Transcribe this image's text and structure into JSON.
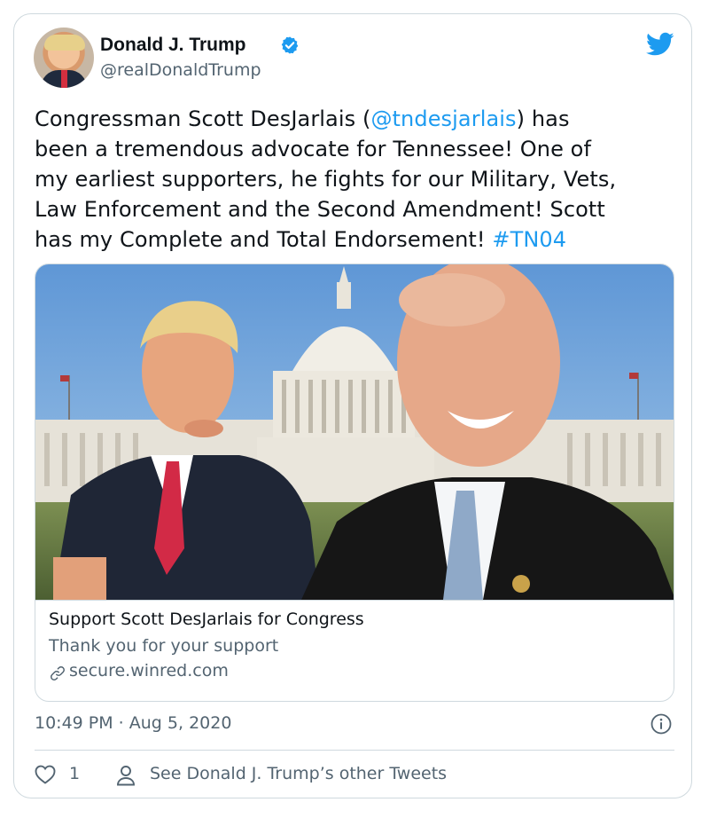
{
  "tweet": {
    "author_name": "Donald J. Trump",
    "author_handle": "@realDonaldTrump",
    "text_lines": [
      {
        "before": "Congressman Scott DesJarlais (",
        "link": "@tndesjarlais",
        "after": ") has"
      },
      {
        "before": "been a tremendous advocate for Tennessee! One of",
        "link": "",
        "after": ""
      },
      {
        "before": "my earliest supporters, he fights for our Military, Vets,",
        "link": "",
        "after": ""
      },
      {
        "before": "Law Enforcement and the Second Amendment! Scott",
        "link": "",
        "after": ""
      },
      {
        "before": "has my Complete and Total Endorsement! ",
        "link": "#TN04",
        "after": ""
      }
    ],
    "link_color": "#1d9bf0",
    "timestamp": "10:49 PM · Aug 5, 2020",
    "like_count": "1",
    "other_tweets_label": "See Donald J. Trump’s other Tweets"
  },
  "link_card": {
    "title": "Support Scott DesJarlais for Congress",
    "description": "Thank you for your support",
    "domain": "secure.winred.com"
  },
  "icons": {
    "verified": "verified-badge-icon",
    "brand": "twitter-bird-icon",
    "link": "link-icon",
    "info": "info-icon",
    "like": "heart-icon",
    "profile": "person-icon"
  }
}
